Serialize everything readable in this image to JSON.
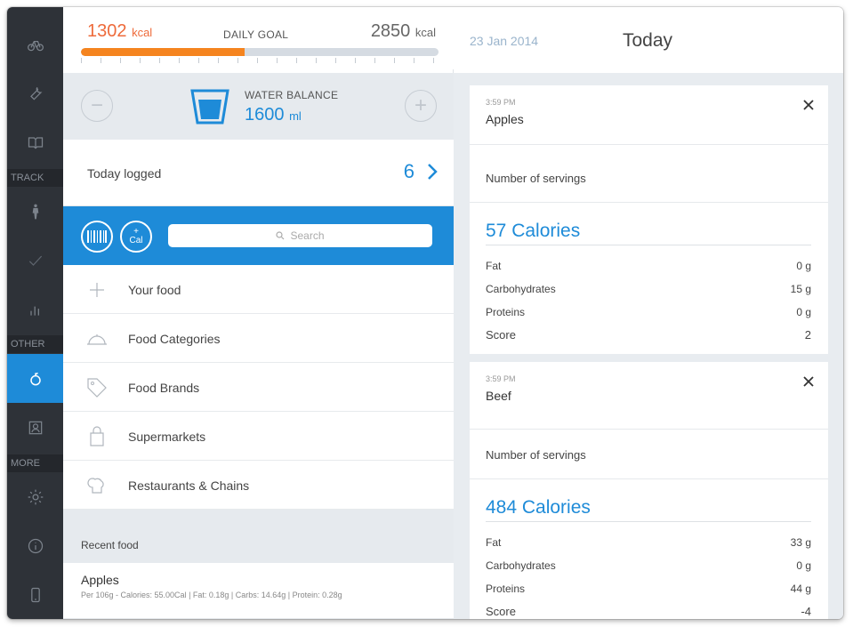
{
  "sidebar": {
    "sections": [
      "TRACK",
      "OTHER",
      "MORE"
    ],
    "items": [
      {
        "icon": "bike-icon"
      },
      {
        "icon": "wrench-icon"
      },
      {
        "icon": "book-icon"
      },
      {
        "icon": "person-icon"
      },
      {
        "icon": "checkmark-icon"
      },
      {
        "icon": "bar-chart-icon"
      },
      {
        "icon": "apple-icon",
        "active": true
      },
      {
        "icon": "profile-icon"
      },
      {
        "icon": "settings-icon"
      },
      {
        "icon": "info-icon"
      },
      {
        "icon": "phone-icon"
      }
    ]
  },
  "goal": {
    "current_value": "1302",
    "current_unit": "kcal",
    "label": "DAILY GOAL",
    "target_value": "2850",
    "target_unit": "kcal",
    "progress_fraction": 0.457,
    "accent": "#f5841f"
  },
  "water": {
    "label": "WATER BALANCE",
    "value": "1600",
    "unit": "ml",
    "minus": "−",
    "plus": "+"
  },
  "today_logged": {
    "label": "Today logged",
    "count": "6"
  },
  "toolbar": {
    "cal_top": "+",
    "cal_bottom": "Cal",
    "search_placeholder": "Search"
  },
  "menu": [
    {
      "label": "Your food",
      "icon": "plus-icon"
    },
    {
      "label": "Food Categories",
      "icon": "dish-icon"
    },
    {
      "label": "Food Brands",
      "icon": "tag-icon"
    },
    {
      "label": "Supermarkets",
      "icon": "bag-icon"
    },
    {
      "label": "Restaurants & Chains",
      "icon": "chef-hat-icon"
    }
  ],
  "recent": {
    "header": "Recent food",
    "items": [
      {
        "name": "Apples",
        "detail": "Per 106g - Calories: 55.00Cal | Fat: 0.18g | Carbs: 14.64g | Protein: 0.28g"
      }
    ]
  },
  "right": {
    "date": "23 Jan 2014",
    "title": "Today",
    "entries": [
      {
        "time": "3:59 PM",
        "name": "Apples",
        "servings_label": "Number of servings",
        "calories": "57 Calories",
        "nutrients": [
          {
            "label": "Fat",
            "value": "0 g"
          },
          {
            "label": "Carbohydrates",
            "value": "15 g"
          },
          {
            "label": "Proteins",
            "value": "0 g"
          },
          {
            "label": "Score",
            "value": "2"
          }
        ]
      },
      {
        "time": "3:59 PM",
        "name": "Beef",
        "servings_label": "Number of servings",
        "calories": "484 Calories",
        "nutrients": [
          {
            "label": "Fat",
            "value": "33 g"
          },
          {
            "label": "Carbohydrates",
            "value": "0 g"
          },
          {
            "label": "Proteins",
            "value": "44 g"
          },
          {
            "label": "Score",
            "value": "-4"
          }
        ]
      }
    ]
  },
  "colors": {
    "primary": "#1e8bd8",
    "sidebar": "#2e3238",
    "calorie_orange": "#ee6b3b"
  }
}
